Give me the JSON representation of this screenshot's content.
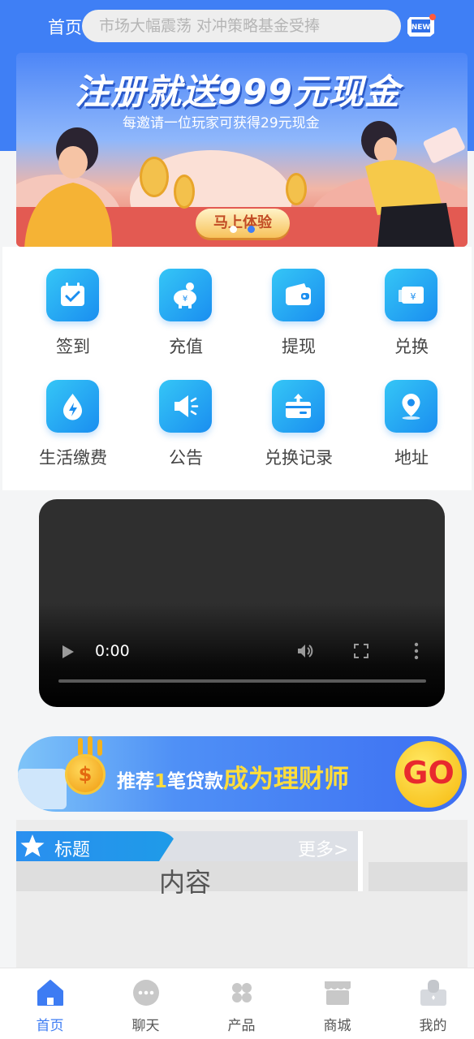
{
  "header": {
    "home_label": "首页",
    "search_placeholder": "市场大幅震荡 对冲策略基金受捧",
    "new_badge": "NEW"
  },
  "banner": {
    "title": "注册就送999元现金",
    "subtitle": "每邀请一位玩家可获得29元现金",
    "button_label": "马上体验",
    "active_slide": 2,
    "slide_count": 2
  },
  "grid": {
    "items": [
      {
        "label": "签到",
        "icon": "calendar-check-icon"
      },
      {
        "label": "充值",
        "icon": "piggy-bank-icon"
      },
      {
        "label": "提现",
        "icon": "wallet-icon"
      },
      {
        "label": "兑换",
        "icon": "ticket-exchange-icon"
      },
      {
        "label": "生活缴费",
        "icon": "water-drop-bolt-icon"
      },
      {
        "label": "公告",
        "icon": "megaphone-icon"
      },
      {
        "label": "兑换记录",
        "icon": "card-upload-icon"
      },
      {
        "label": "地址",
        "icon": "location-pin-icon"
      }
    ]
  },
  "video": {
    "time": "0:00",
    "progress": 0
  },
  "ad": {
    "prefix": "推荐",
    "number": "1",
    "middle": "笔贷款",
    "highlight": "成为理财师",
    "go_label": "GO",
    "coin_symbol": "$"
  },
  "news": {
    "title": "标题",
    "more": "更多>",
    "content": "内容"
  },
  "tabbar": {
    "items": [
      {
        "label": "首页",
        "icon": "home-icon",
        "active": true
      },
      {
        "label": "聊天",
        "icon": "chat-icon",
        "active": false
      },
      {
        "label": "产品",
        "icon": "product-icon",
        "active": false
      },
      {
        "label": "商城",
        "icon": "store-icon",
        "active": false
      },
      {
        "label": "我的",
        "icon": "profile-icon",
        "active": false
      }
    ]
  },
  "colors": {
    "primary": "#3f7ff5",
    "icon_gradient_start": "#35c6f6",
    "icon_gradient_end": "#1a8ef0",
    "tab_active": "#3d7cf3",
    "tab_inactive": "#c8c8c8"
  }
}
